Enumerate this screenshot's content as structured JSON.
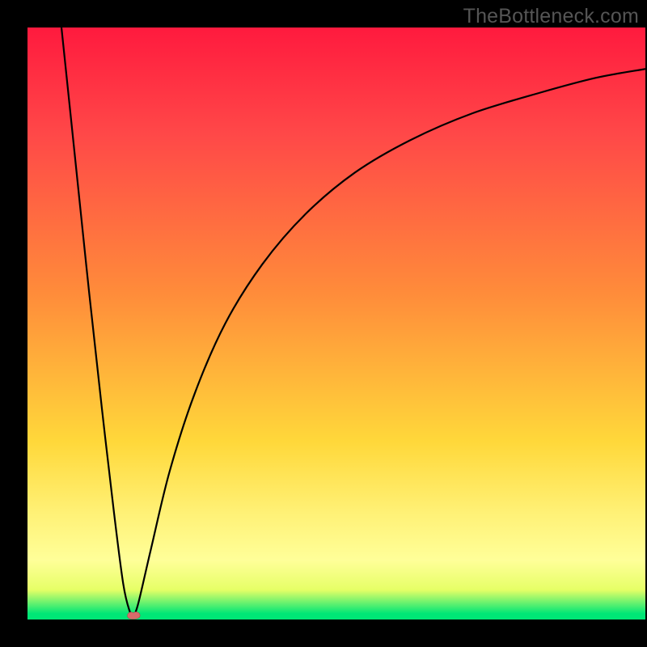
{
  "watermark": "TheBottleneck.com",
  "colors": {
    "frame": "#000000",
    "curve": "#000000",
    "marker_fill": "#d86a6a",
    "marker_stroke": "#b24b4b"
  },
  "chart_data": {
    "type": "line",
    "title": "",
    "xlabel": "",
    "ylabel": "",
    "xlim": [
      0,
      100
    ],
    "ylim": [
      0,
      100
    ],
    "grid": false,
    "legend": false,
    "series": [
      {
        "name": "left-branch",
        "x": [
          5.5,
          8,
          10,
          12,
          14,
          15.5,
          16.5,
          17.2
        ],
        "y": [
          100,
          75,
          55,
          36,
          18,
          6,
          1.5,
          0.5
        ]
      },
      {
        "name": "right-branch",
        "x": [
          17.2,
          18,
          20,
          23,
          27,
          32,
          38,
          45,
          53,
          62,
          72,
          83,
          92,
          100
        ],
        "y": [
          0.5,
          3,
          12,
          25,
          38,
          50,
          60,
          68.5,
          75.5,
          81,
          85.5,
          89,
          91.5,
          93
        ]
      }
    ],
    "annotations": [
      {
        "name": "minimum-marker",
        "x": 17.2,
        "y": 0.5
      }
    ],
    "background_gradient_stops": [
      {
        "pos": 0,
        "color": "#ff1a3e"
      },
      {
        "pos": 18,
        "color": "#ff4848"
      },
      {
        "pos": 45,
        "color": "#ff8c3a"
      },
      {
        "pos": 70,
        "color": "#ffd83a"
      },
      {
        "pos": 82,
        "color": "#fff176"
      },
      {
        "pos": 90,
        "color": "#ffff99"
      },
      {
        "pos": 95,
        "color": "#e6ff66"
      },
      {
        "pos": 99,
        "color": "#00e676"
      },
      {
        "pos": 100,
        "color": "#00e676"
      }
    ]
  }
}
